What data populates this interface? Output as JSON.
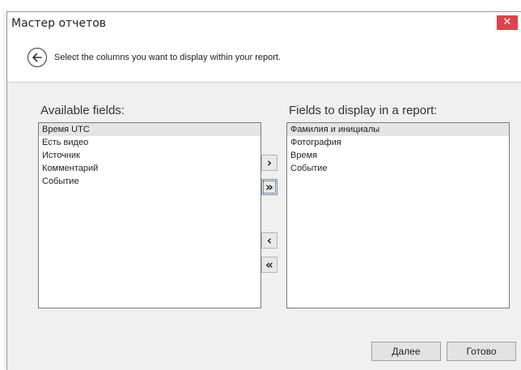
{
  "window": {
    "title": "Мастер отчетов",
    "close_label": "✕"
  },
  "header": {
    "instruction": "Select the columns you want to display within your report."
  },
  "available": {
    "label": "Available fields:",
    "items": [
      "Время UTC",
      "Есть видео",
      "Источник",
      "Комментарий",
      "Событие"
    ],
    "selected_index": 0
  },
  "display": {
    "label": "Fields to display in a report:",
    "items": [
      "Фамилия и инициалы",
      "Фотография",
      "Время",
      "Событие"
    ],
    "selected_index": 0
  },
  "move_buttons": {
    "add_one": "›",
    "add_all": "»",
    "remove_one": "‹",
    "remove_all": "«"
  },
  "footer": {
    "next_label": "Далее",
    "finish_label": "Готово"
  },
  "colors": {
    "close_button": "#e0434a",
    "dialog_background": "#f0f0f0",
    "selection": "#e5e5e5"
  }
}
